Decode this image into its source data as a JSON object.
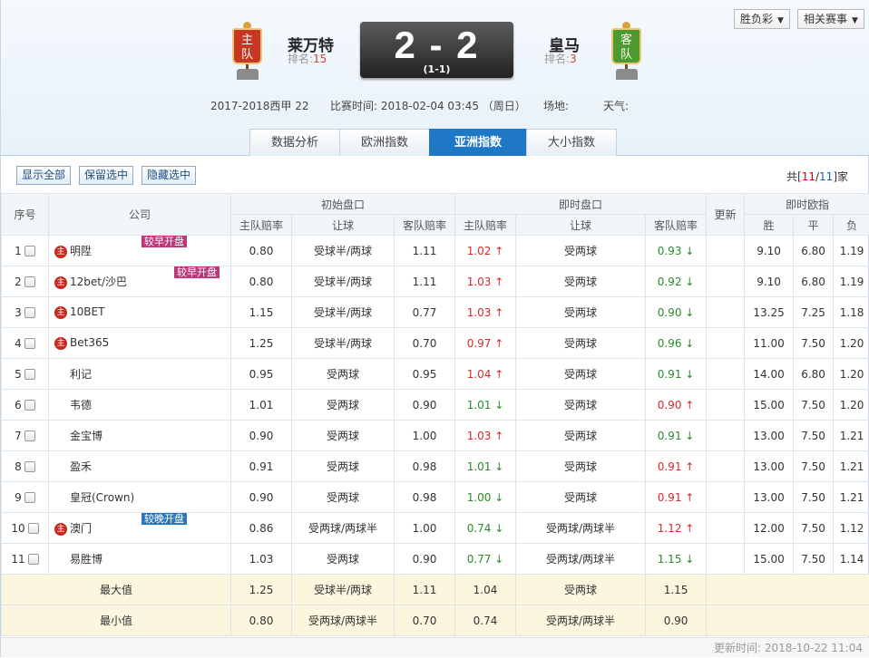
{
  "header": {
    "home": {
      "badge": "主\n队",
      "name": "莱万特",
      "rank_label": "排名:",
      "rank": "15"
    },
    "away": {
      "badge": "客\n队",
      "name": "皇马",
      "rank_label": "排名:",
      "rank": "3"
    },
    "score": {
      "main": "2 - 2",
      "half": "(1-1)"
    },
    "league": "2017-2018西甲 22",
    "match_time": "比赛时间: 2018-02-04 03:45 （周日）",
    "venue": "场地:",
    "weather": "天气:",
    "dropdowns": {
      "lottery": "胜负彩",
      "related": "相关赛事"
    }
  },
  "tabs": [
    {
      "label": "数据分析",
      "active": false
    },
    {
      "label": "欧洲指数",
      "active": false
    },
    {
      "label": "亚洲指数",
      "active": true
    },
    {
      "label": "大小指数",
      "active": false
    }
  ],
  "toolbar": {
    "show_all": "显示全部",
    "keep_selected": "保留选中",
    "hide_selected": "隐藏选中",
    "total_prefix": "共[",
    "total_current": "11",
    "total_sep": "/",
    "total_all": "11",
    "total_suffix": "]家"
  },
  "table": {
    "headers": {
      "index": "序号",
      "company": "公司",
      "initial": "初始盘口",
      "live": "即时盘口",
      "update": "更新",
      "europe": "即时欧指",
      "home_odds": "主队赔率",
      "handicap": "让球",
      "away_odds": "客队赔率",
      "win": "胜",
      "draw": "平",
      "lose": "负"
    },
    "rows": [
      {
        "idx": "1",
        "zhu": true,
        "company": "明陞",
        "tag": "较早开盘",
        "tag_type": "early",
        "i_home": "0.80",
        "i_hcp": "受球半/两球",
        "i_away": "1.11",
        "l_home": "1.02",
        "l_home_dir": "up",
        "l_hcp": "受两球",
        "l_away": "0.93",
        "l_away_dir": "dn",
        "win": "9.10",
        "draw": "6.80",
        "lose": "1.19"
      },
      {
        "idx": "2",
        "zhu": true,
        "company": "12bet/沙巴",
        "tag": "较早开盘",
        "tag_type": "early",
        "i_home": "0.80",
        "i_hcp": "受球半/两球",
        "i_away": "1.11",
        "l_home": "1.03",
        "l_home_dir": "up",
        "l_hcp": "受两球",
        "l_away": "0.92",
        "l_away_dir": "dn",
        "win": "9.10",
        "draw": "6.80",
        "lose": "1.19"
      },
      {
        "idx": "3",
        "zhu": true,
        "company": "10BET",
        "tag": "",
        "tag_type": "",
        "i_home": "1.15",
        "i_hcp": "受球半/两球",
        "i_away": "0.77",
        "l_home": "1.03",
        "l_home_dir": "up",
        "l_hcp": "受两球",
        "l_away": "0.90",
        "l_away_dir": "dn",
        "win": "13.25",
        "draw": "7.25",
        "lose": "1.18"
      },
      {
        "idx": "4",
        "zhu": true,
        "company": "Bet365",
        "tag": "",
        "tag_type": "",
        "i_home": "1.25",
        "i_hcp": "受球半/两球",
        "i_away": "0.70",
        "l_home": "0.97",
        "l_home_dir": "up",
        "l_hcp": "受两球",
        "l_away": "0.96",
        "l_away_dir": "dn",
        "win": "11.00",
        "draw": "7.50",
        "lose": "1.20"
      },
      {
        "idx": "5",
        "zhu": false,
        "company": "利记",
        "tag": "",
        "tag_type": "",
        "i_home": "0.95",
        "i_hcp": "受两球",
        "i_away": "0.95",
        "l_home": "1.04",
        "l_home_dir": "up",
        "l_hcp": "受两球",
        "l_away": "0.91",
        "l_away_dir": "dn",
        "win": "14.00",
        "draw": "6.80",
        "lose": "1.20"
      },
      {
        "idx": "6",
        "zhu": false,
        "company": "韦德",
        "tag": "",
        "tag_type": "",
        "i_home": "1.01",
        "i_hcp": "受两球",
        "i_away": "0.90",
        "l_home": "1.01",
        "l_home_dir": "dn",
        "l_hcp": "受两球",
        "l_away": "0.90",
        "l_away_dir": "up",
        "win": "15.00",
        "draw": "7.50",
        "lose": "1.20"
      },
      {
        "idx": "7",
        "zhu": false,
        "company": "金宝博",
        "tag": "",
        "tag_type": "",
        "i_home": "0.90",
        "i_hcp": "受两球",
        "i_away": "1.00",
        "l_home": "1.03",
        "l_home_dir": "up",
        "l_hcp": "受两球",
        "l_away": "0.91",
        "l_away_dir": "dn",
        "win": "13.00",
        "draw": "7.50",
        "lose": "1.21"
      },
      {
        "idx": "8",
        "zhu": false,
        "company": "盈禾",
        "tag": "",
        "tag_type": "",
        "i_home": "0.91",
        "i_hcp": "受两球",
        "i_away": "0.98",
        "l_home": "1.01",
        "l_home_dir": "dn",
        "l_hcp": "受两球",
        "l_away": "0.91",
        "l_away_dir": "up",
        "win": "13.00",
        "draw": "7.50",
        "lose": "1.21"
      },
      {
        "idx": "9",
        "zhu": false,
        "company": "皇冠(Crown)",
        "tag": "",
        "tag_type": "",
        "i_home": "0.90",
        "i_hcp": "受两球",
        "i_away": "0.98",
        "l_home": "1.00",
        "l_home_dir": "dn",
        "l_hcp": "受两球",
        "l_away": "0.91",
        "l_away_dir": "up",
        "win": "13.00",
        "draw": "7.50",
        "lose": "1.21"
      },
      {
        "idx": "10",
        "zhu": true,
        "company": "澳门",
        "tag": "较晚开盘",
        "tag_type": "late",
        "i_home": "0.86",
        "i_hcp": "受两球/两球半",
        "i_away": "1.00",
        "l_home": "0.74",
        "l_home_dir": "dn",
        "l_hcp": "受两球/两球半",
        "l_away": "1.12",
        "l_away_dir": "up",
        "win": "12.00",
        "draw": "7.50",
        "lose": "1.12"
      },
      {
        "idx": "11",
        "zhu": false,
        "company": "易胜博",
        "tag": "",
        "tag_type": "",
        "i_home": "1.03",
        "i_hcp": "受两球",
        "i_away": "0.90",
        "l_home": "0.77",
        "l_home_dir": "dn",
        "l_hcp": "受两球/两球半",
        "l_away": "1.15",
        "l_away_dir": "dn",
        "win": "15.00",
        "draw": "7.50",
        "lose": "1.14"
      }
    ],
    "stats": [
      {
        "label": "最大值",
        "i_home": "1.25",
        "i_hcp": "受球半/两球",
        "i_away": "1.11",
        "l_home": "1.04",
        "l_hcp": "受两球",
        "l_away": "1.15"
      },
      {
        "label": "最小值",
        "i_home": "0.80",
        "i_hcp": "受两球/两球半",
        "i_away": "0.70",
        "l_home": "0.74",
        "l_hcp": "受两球/两球半",
        "l_away": "0.90"
      }
    ],
    "arrows": {
      "up": "↑",
      "dn": "↓"
    },
    "zhu_char": "主"
  },
  "footer": {
    "update_time": "更新时间: 2018-10-22 11:04"
  },
  "colors": {
    "tab_active": "#1f78c6",
    "up": "#d62a2a",
    "down": "#2b8a2b",
    "home_flag": "#c83723",
    "away_flag": "#4c9a30",
    "early_tag": "#c03779",
    "late_tag": "#2977bd"
  }
}
